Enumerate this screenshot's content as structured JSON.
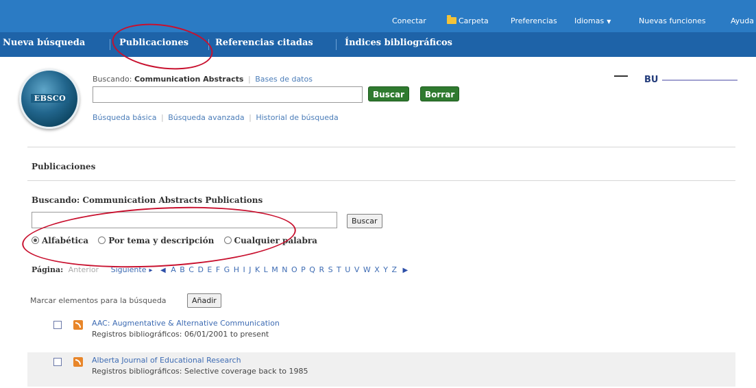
{
  "topbar": {
    "links": [
      "Conectar",
      "Carpeta",
      "Preferencias",
      "Idiomas",
      "Nuevas funciones",
      "Ayuda"
    ]
  },
  "nav": {
    "items": [
      "Nueva búsqueda",
      "Publicaciones",
      "Referencias citadas",
      "Índices bibliográficos"
    ]
  },
  "logo": {
    "text": "EBSCO"
  },
  "search": {
    "label_prefix": "Buscando:",
    "database": "Communication Abstracts",
    "db_link": "Bases de datos",
    "buscar": "Buscar",
    "borrar": "Borrar",
    "links": [
      "Búsqueda básica",
      "Búsqueda avanzada",
      "Historial de búsqueda"
    ]
  },
  "partner": {
    "bu": "BU"
  },
  "publications": {
    "title": "Publicaciones",
    "searching_label": "Buscando: Communication Abstracts Publications",
    "buscar": "Buscar",
    "radios": [
      {
        "label": "Alfabética",
        "selected": true
      },
      {
        "label": "Por tema y descripción",
        "selected": false
      },
      {
        "label": "Cualquier palabra",
        "selected": false
      }
    ],
    "pager": {
      "label": "Página:",
      "prev": "Anterior",
      "next": "Siguiente",
      "letters": "A B C D E F G H I J K L M N O P Q R S T U V W X Y Z"
    },
    "mark_label": "Marcar elementos para la búsqueda",
    "add_button": "Añadir",
    "results": [
      {
        "title": "AAC: Augmentative & Alternative Communication",
        "records": "Registros bibliográficos: 06/01/2001 to present"
      },
      {
        "title": "Alberta Journal of Educational Research",
        "records": "Registros bibliográficos: Selective coverage back to 1985"
      }
    ]
  },
  "colors": {
    "topbar": "#2b7bc4",
    "navbar": "#1e63a8",
    "green_button": "#2f7a2f",
    "link": "#3d6bb3",
    "annotation": "#c8102e"
  }
}
